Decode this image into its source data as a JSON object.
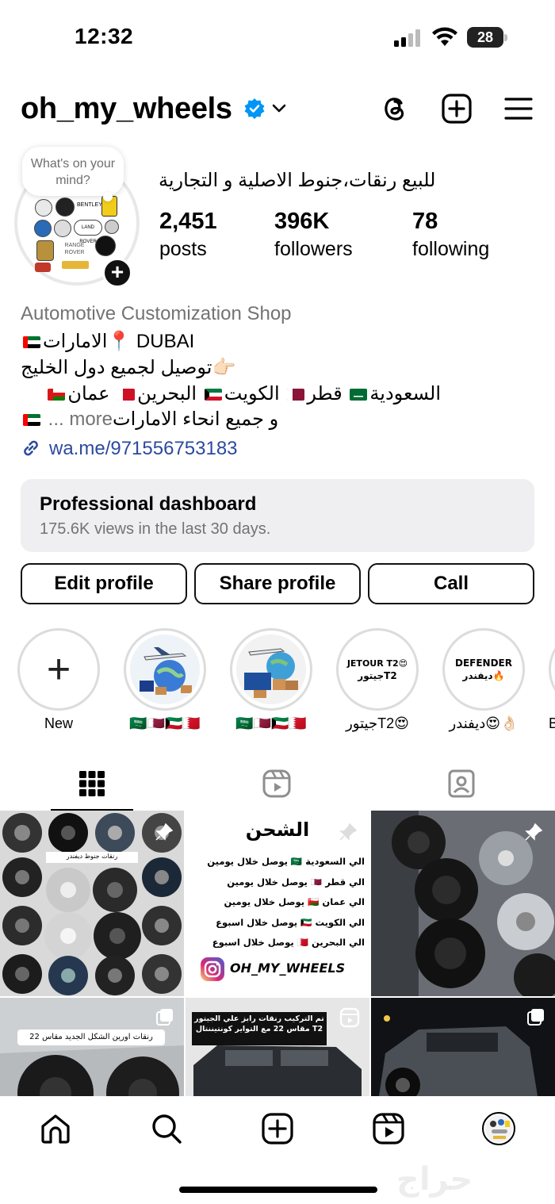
{
  "status_bar": {
    "time": "12:32",
    "battery": "28"
  },
  "header": {
    "username": "oh_my_wheels",
    "icons": [
      "threads-icon",
      "create-plus-icon",
      "menu-hamburger-icon"
    ]
  },
  "profile": {
    "note": "What's on your mind?",
    "full_name": "للبيع رنقات،جنوط الاصلية و التجارية",
    "stats": [
      {
        "value": "2,451",
        "label": "posts"
      },
      {
        "value": "396K",
        "label": "followers"
      },
      {
        "value": "78",
        "label": "following"
      }
    ]
  },
  "bio": {
    "category": "Automotive Customization Shop",
    "line1": "الامارات📍 DUBAI",
    "line2": "توصيل لجميع دول الخليج👉🏻",
    "line3_parts": [
      "السعودية",
      "قطر",
      "الكويت",
      "البحرين",
      "عمان"
    ],
    "line4": "و جميع انحاء الامارات",
    "more": "... more",
    "link": "wa.me/971556753183"
  },
  "dashboard": {
    "title": "Professional dashboard",
    "subtitle": "175.6K views in the last 30 days."
  },
  "buttons": {
    "edit": "Edit profile",
    "share": "Share profile",
    "call": "Call"
  },
  "highlights": [
    {
      "label": "New"
    },
    {
      "label": "🇸🇦🇶🇦🇰🇼🇧🇭"
    },
    {
      "label": "🇸🇦🇶🇦🇰🇼🇧🇭"
    },
    {
      "label": "جيتورT2😍",
      "inner_line1": "JETOUR T2😍",
      "inner_line2": "جيتورT2"
    },
    {
      "label": "ديفندر😍👌🏻",
      "inner_line1": "DEFENDER",
      "inner_line2": "ديفندر🔥"
    },
    {
      "label": "B"
    }
  ],
  "grid": {
    "post1_caption": "رنقات جنوط ديفندر",
    "post2": {
      "title": "الشحن",
      "lines": [
        "الي السعودية 🇸🇦 يوصل خلال يومين",
        "الي قطر 🇶🇦 يوصل خلال يومين",
        "الي عمان 🇴🇲 يوصل خلال يومين",
        "الي الكويت 🇰🇼 يوصل خلال اسبوع",
        "الي البحرين 🇧🇭 يوصل خلال اسبوع"
      ],
      "brand": "OH_MY_WHEELS"
    },
    "post4_caption": "رنقات اورين الشكل الجديد مقاس 22",
    "post5_caption": "تم التركيب رنقات رابز علي الجيتور T2 مقاس 22 مع التواير كونتيننتال"
  },
  "colors": {
    "accent": "#0095f6",
    "link": "#2c4a9e",
    "muted": "#737373",
    "card_bg": "#efeff1"
  },
  "watermark": "حراج"
}
